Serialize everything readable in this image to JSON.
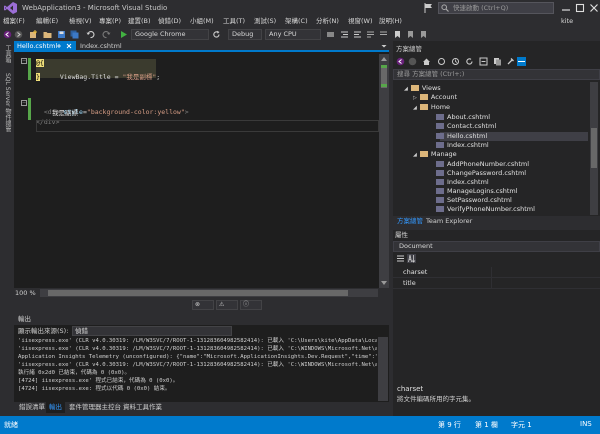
{
  "window": {
    "title": "WebApplication3 - Microsoft Visual Studio",
    "quick_launch_placeholder": "快速啟動 (Ctrl+Q)",
    "user": "kite"
  },
  "menu": [
    "檔案(F)",
    "編輯(E)",
    "檢視(V)",
    "專案(P)",
    "建置(B)",
    "偵錯(D)",
    "小組(M)",
    "工具(T)",
    "測試(S)",
    "架構(C)",
    "分析(N)",
    "視窗(W)",
    "說明(H)"
  ],
  "toolbar": {
    "browser": "Google Chrome",
    "config": "Debug",
    "platform": "Any CPU"
  },
  "left_strip": {
    "toolbox": "工具箱",
    "sql_explorer": "SQL Server 物件總管"
  },
  "editor": {
    "tabs": [
      {
        "label": "Hello.cshtml",
        "active": true
      },
      {
        "label": "Index.cshtml",
        "active": false
      }
    ],
    "code": {
      "l1_at": "@{",
      "l2_key": "ViewBag.Title = ",
      "l2_str": "\"我是副標\"",
      "l2_end": ";",
      "l3_close": "}",
      "l5_open": "<div ",
      "l5_attr": "style",
      "l5_eq": "=",
      "l5_val": "\"background-color:yellow\"",
      "l5_gt": ">",
      "l6_text": "我是副標",
      "l7_close": "</div>"
    },
    "zoom": "100 %"
  },
  "output": {
    "title": "輸出",
    "source_label": "顯示輸出來源(S):",
    "source": "偵錯",
    "lines": [
      "'iisexpress.exe' (CLR v4.0.30319: /LM/W3SVC/7/ROOT-1-131283604982582414): 已載入 'C:\\Users\\kite\\AppData\\Local\\Te",
      "'iisexpress.exe' (CLR v4.0.30319: /LM/W3SVC/7/ROOT-1-131283604982582414): 已載入 'C:\\WINDOWS\\Microsoft.Net\\assemb",
      "Application Insights Telemetry (unconfigured): {\"name\":\"Microsoft.ApplicationInsights.Dev.Request\",\"time\":\"2017-01",
      "'iisexpress.exe' (CLR v4.0.30319: /LM/W3SVC/7/ROOT-1-131283604982582414): 已載入 'C:\\WINDOWS\\Microsoft.Net\\assemb",
      "執行緒 0x2d0 已結束，代碼為 0 (0x0)。",
      "[4724] iisexpress.exe' 程式已結束，代碼為 0 (0x0)。",
      "[4724] iisexpress.exe: 程式以代碼 0 (0x0) 結束。"
    ]
  },
  "bottom_tabs": [
    "錯誤清單",
    "輸出",
    "套件管理器主控台",
    "資料工具作業"
  ],
  "solution_explorer": {
    "title": "方案總管",
    "search_placeholder": "搜尋 方案總管 (Ctrl+;)",
    "items": [
      {
        "label": "Views",
        "kind": "folder",
        "level": 0,
        "expanded": true
      },
      {
        "label": "Account",
        "kind": "folder",
        "level": 1,
        "expanded": false
      },
      {
        "label": "Home",
        "kind": "folder",
        "level": 1,
        "expanded": true
      },
      {
        "label": "About.cshtml",
        "kind": "file",
        "level": 2
      },
      {
        "label": "Contact.cshtml",
        "kind": "file",
        "level": 2
      },
      {
        "label": "Hello.cshtml",
        "kind": "file",
        "level": 2,
        "selected": true
      },
      {
        "label": "Index.cshtml",
        "kind": "file",
        "level": 2
      },
      {
        "label": "Manage",
        "kind": "folder",
        "level": 1,
        "expanded": true
      },
      {
        "label": "AddPhoneNumber.cshtml",
        "kind": "file",
        "level": 2
      },
      {
        "label": "ChangePassword.cshtml",
        "kind": "file",
        "level": 2
      },
      {
        "label": "Index.cshtml",
        "kind": "file",
        "level": 2
      },
      {
        "label": "ManageLogins.cshtml",
        "kind": "file",
        "level": 2
      },
      {
        "label": "SetPassword.cshtml",
        "kind": "file",
        "level": 2
      },
      {
        "label": "VerifyPhoneNumber.cshtml",
        "kind": "file",
        "level": 2
      }
    ],
    "tabs": [
      "方案總管",
      "Team Explorer"
    ]
  },
  "properties": {
    "title": "屬性",
    "object": "Document",
    "rows": [
      "charset",
      "title"
    ],
    "desc_name": "charset",
    "desc_text": "將文件編碼所用的字元集。"
  },
  "status": {
    "ready": "就緒",
    "line": "第 9 行",
    "col": "第 1 欄",
    "ch": "字元 1",
    "mode": "INS"
  },
  "colors": {
    "accent": "#007acc",
    "razor_bg": "#3b3b2e",
    "string": "#d69d85",
    "tag": "#808080",
    "element": "#569cd6",
    "attribute": "#9cdcfe"
  }
}
